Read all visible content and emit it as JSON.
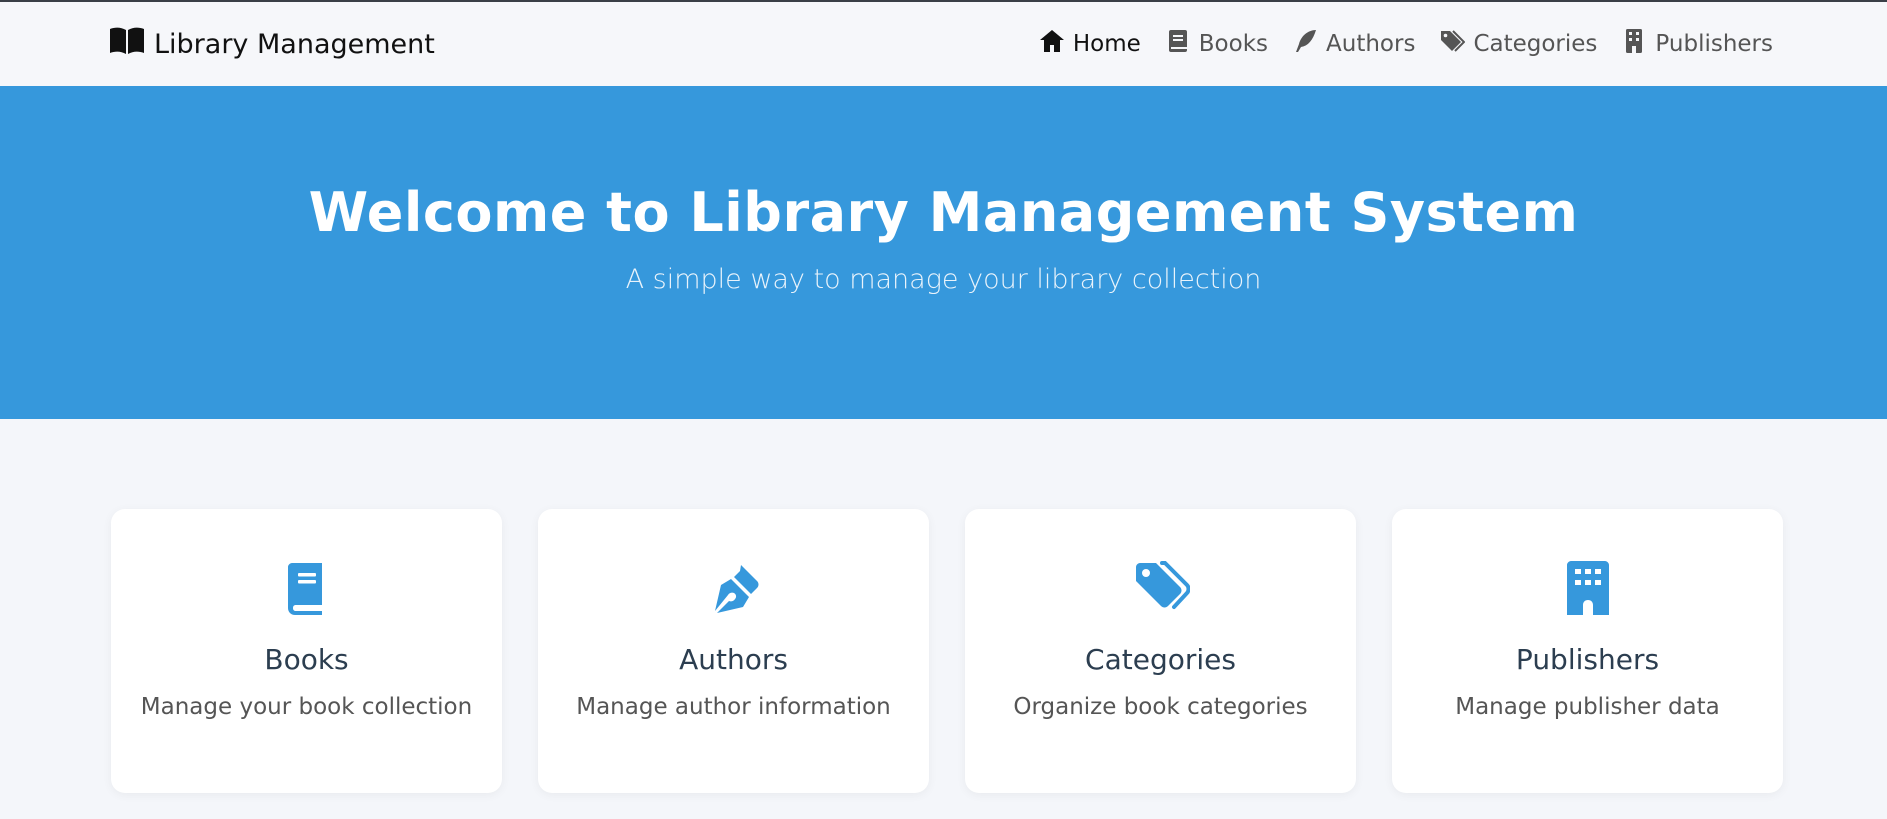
{
  "navbar": {
    "brand": "Library Management",
    "links": [
      {
        "label": "Home",
        "icon": "home-icon",
        "active": true
      },
      {
        "label": "Books",
        "icon": "book-icon"
      },
      {
        "label": "Authors",
        "icon": "feather-icon"
      },
      {
        "label": "Categories",
        "icon": "tags-icon"
      },
      {
        "label": "Publishers",
        "icon": "building-icon"
      }
    ]
  },
  "hero": {
    "title": "Welcome to Library Management System",
    "subtitle": "A simple way to manage your library collection"
  },
  "cards": [
    {
      "title": "Books",
      "description": "Manage your book collection",
      "icon": "book-icon"
    },
    {
      "title": "Authors",
      "description": "Manage author information",
      "icon": "pen-nib-icon"
    },
    {
      "title": "Categories",
      "description": "Organize book categories",
      "icon": "tags-icon"
    },
    {
      "title": "Publishers",
      "description": "Manage publisher data",
      "icon": "building-icon"
    }
  ],
  "colors": {
    "primary": "#3698dc",
    "background": "#f4f6fa",
    "heading": "#2c3e50",
    "muted": "#555555"
  }
}
